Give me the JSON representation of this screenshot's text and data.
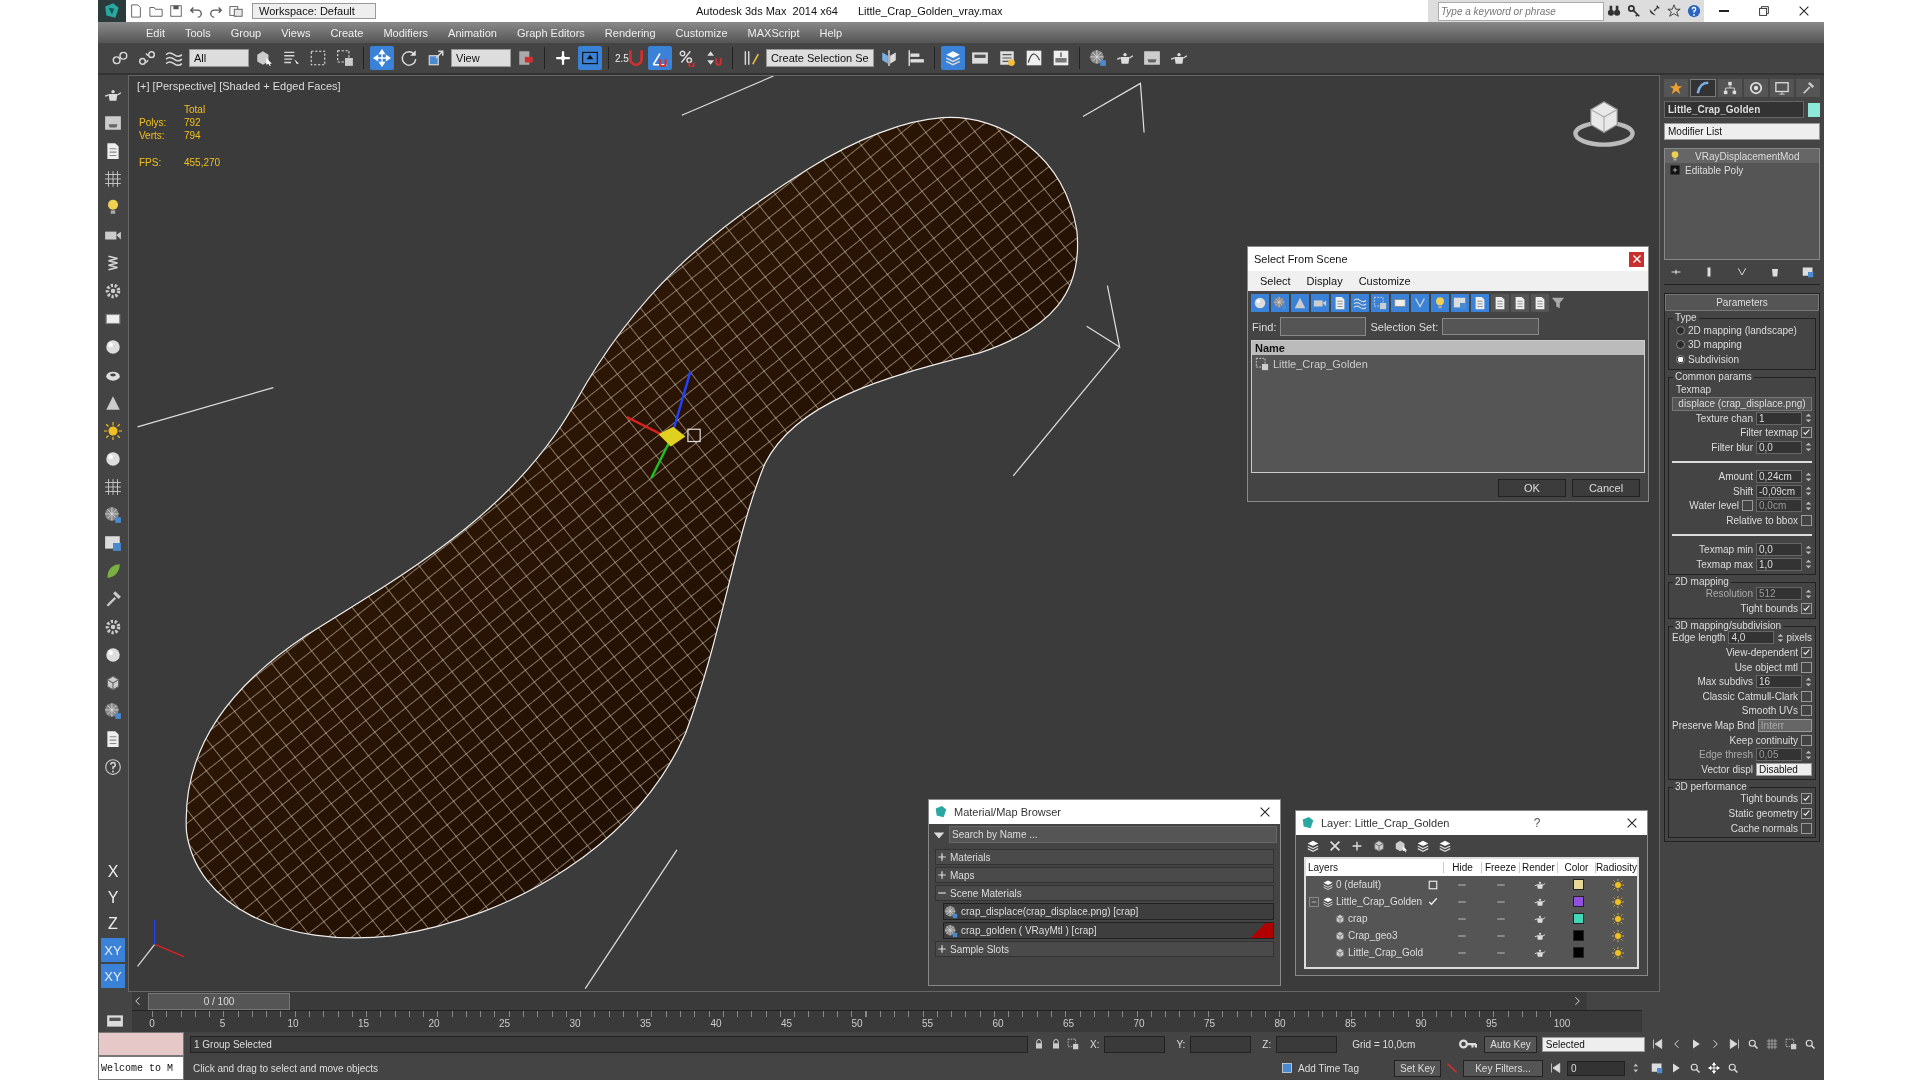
{
  "title_bar": {
    "workspace": "Workspace: Default",
    "app_title": "Autodesk 3ds Max  2014 x64",
    "file_name": "Little_Crap_Golden_vray.max",
    "search": {
      "placeholder": "Type a keyword or phrase"
    }
  },
  "menu": [
    "Edit",
    "Tools",
    "Group",
    "Views",
    "Create",
    "Modifiers",
    "Animation",
    "Graph Editors",
    "Rendering",
    "Customize",
    "MAXScript",
    "Help"
  ],
  "main_toolbar": {
    "dropdowns": [
      "All",
      "View",
      "Create Selection Se"
    ],
    "tools": [
      {
        "selected": false
      },
      {
        "selected": false
      },
      {
        "selected": false
      },
      {
        "selected": false
      },
      {
        "selected": false
      },
      {
        "selected": false
      },
      {
        "selected": false
      },
      {
        "selected": true
      },
      {
        "selected": false
      },
      {
        "selected": false
      },
      {
        "selected": false
      },
      {
        "selected": false
      },
      {
        "selected": true
      },
      {
        "selected": false,
        "label": "2.5"
      },
      {
        "selected": true
      },
      {
        "selected": false
      },
      {
        "selected": false
      },
      {
        "selected": false
      },
      {
        "selected": false
      },
      {
        "selected": false
      },
      {
        "selected": true
      },
      {
        "selected": false
      },
      {
        "selected": false
      },
      {
        "selected": false
      },
      {
        "selected": false
      },
      {
        "selected": false
      },
      {
        "selected": false
      },
      {
        "selected": false
      },
      {
        "selected": false
      }
    ]
  },
  "axis_buttons": [
    {
      "label": "X",
      "selected": false
    },
    {
      "label": "Y",
      "selected": false
    },
    {
      "label": "Z",
      "selected": false
    },
    {
      "label": "XY",
      "selected": true
    },
    {
      "label": "XY",
      "selected": true
    }
  ],
  "viewport": {
    "label": "[+] [Perspective] [Shaded + Edged Faces]",
    "stats_heading": "Total",
    "stats": [
      {
        "label": "Polys:",
        "value": "792"
      },
      {
        "label": "Verts:",
        "value": "794"
      }
    ],
    "fps": {
      "label": "FPS:",
      "value": "455,270"
    }
  },
  "select_from_scene": {
    "title": "Select From Scene",
    "menus": [
      "Select",
      "Display",
      "Customize"
    ],
    "filters": [
      {
        "selected": true
      },
      {
        "selected": true
      },
      {
        "selected": true
      },
      {
        "selected": true
      },
      {
        "selected": true
      },
      {
        "selected": true
      },
      {
        "selected": true
      },
      {
        "selected": true
      },
      {
        "selected": true
      },
      {
        "selected": true
      },
      {
        "selected": true
      },
      {
        "selected": true
      },
      {
        "selected": false
      },
      {
        "selected": false
      },
      {
        "selected": false
      }
    ],
    "find_label": "Find:",
    "selection_set_label": "Selection Set:",
    "column": "Name",
    "rows": [
      "Little_Crap_Golden"
    ],
    "buttons": [
      "OK",
      "Cancel"
    ]
  },
  "material_browser": {
    "title": "Material/Map Browser",
    "search": {
      "placeholder": "Search by Name ..."
    },
    "groups": [
      {
        "label": "Materials",
        "expanded": false
      },
      {
        "label": "Maps",
        "expanded": false
      },
      {
        "label": "Scene Materials",
        "expanded": true,
        "items": [
          {
            "label": "crap_displace(crap_displace.png) [crap]",
            "in_scene": false
          },
          {
            "label": "crap_golden  ( VRayMtl ) [crap]",
            "in_scene": true
          }
        ]
      },
      {
        "label": "Sample Slots",
        "expanded": false
      }
    ]
  },
  "layer_dialog": {
    "title": "Layer: Little_Crap_Golden",
    "help": "?",
    "columns": [
      "Layers",
      "Hide",
      "Freeze",
      "Render",
      "Color",
      "Radiosity"
    ],
    "rows": [
      {
        "name": "0 (default)",
        "kind": "layer",
        "current": false,
        "color": "#e8d898"
      },
      {
        "name": "Little_Crap_Golden",
        "kind": "layer",
        "current": true,
        "expanded": true,
        "color": "#9050e0",
        "children": [
          {
            "name": "crap",
            "kind": "object",
            "color": "#40d8b8"
          },
          {
            "name": "Crap_geo3",
            "kind": "object",
            "color": "#000000"
          },
          {
            "name": "Little_Crap_Gold",
            "kind": "object",
            "color": "#000000"
          }
        ]
      }
    ]
  },
  "command_panel": {
    "tabs": [
      {
        "selected": false
      },
      {
        "selected": true
      },
      {
        "selected": false
      },
      {
        "selected": false
      },
      {
        "selected": false
      },
      {
        "selected": false
      }
    ],
    "object_name": "Little_Crap_Golden",
    "modifier_list": "Modifier List",
    "stack": [
      {
        "label": "VRayDisplacementMod",
        "kind": "modifier",
        "selected": true
      },
      {
        "label": "Editable Poly",
        "kind": "base",
        "selected": false
      }
    ],
    "rollout_title": "Parameters",
    "groups": [
      {
        "title": "Type",
        "rows": [
          {
            "kind": "radio",
            "label": "2D mapping (landscape)",
            "selected": false
          },
          {
            "kind": "radio",
            "label": "3D mapping",
            "selected": false
          },
          {
            "kind": "radio",
            "label": "Subdivision",
            "selected": true
          }
        ]
      },
      {
        "title": "Common params",
        "rows": [
          {
            "kind": "label",
            "label": "Texmap"
          },
          {
            "kind": "button",
            "label": "displace (crap_displace.png)"
          },
          {
            "kind": "spinner",
            "label": "Texture chan",
            "value": "1",
            "disabled": false
          },
          {
            "kind": "checkbox",
            "label": "Filter texmap",
            "checked": true
          },
          {
            "kind": "spinner",
            "label": "Filter blur",
            "value": "0,0",
            "disabled": false
          },
          {
            "kind": "separator"
          },
          {
            "kind": "spinner",
            "label": "Amount",
            "value": "0,24cm",
            "disabled": false
          },
          {
            "kind": "spinner",
            "label": "Shift",
            "value": "-0,09cm",
            "disabled": false
          },
          {
            "kind": "checkspinner",
            "label": "Water level",
            "checked": false,
            "value": "0,0cm",
            "disabled": true
          },
          {
            "kind": "checkbox",
            "label": "Relative to bbox",
            "checked": false
          },
          {
            "kind": "separator"
          },
          {
            "kind": "spinner",
            "label": "Texmap min",
            "value": "0,0",
            "disabled": false
          },
          {
            "kind": "spinner",
            "label": "Texmap max",
            "value": "1,0",
            "disabled": false
          }
        ]
      },
      {
        "title": "2D mapping",
        "rows": [
          {
            "kind": "spinner",
            "label": "Resolution",
            "value": "512",
            "disabled": true
          },
          {
            "kind": "checkbox",
            "label": "Tight bounds",
            "checked": true
          }
        ]
      },
      {
        "title": "3D mapping/subdivision",
        "rows": [
          {
            "kind": "spinner",
            "label": "Edge length",
            "value": "4,0",
            "unit": "pixels",
            "disabled": false
          },
          {
            "kind": "checkbox",
            "label": "View-dependent",
            "checked": true
          },
          {
            "kind": "checkbox",
            "label": "Use object mtl",
            "checked": false
          },
          {
            "kind": "spinner",
            "label": "Max subdivs",
            "value": "16",
            "disabled": false
          },
          {
            "kind": "checkbox",
            "label": "Classic Catmull-Clark",
            "checked": false
          },
          {
            "kind": "checkbox",
            "label": "Smooth UVs",
            "checked": false
          },
          {
            "kind": "dropdown",
            "label": "Preserve Map Bnd",
            "value": "Interr",
            "disabled": true
          },
          {
            "kind": "checkbox",
            "label": "Keep continuity",
            "checked": false
          },
          {
            "kind": "spinner",
            "label": "Edge thresh",
            "value": "0,05",
            "disabled": true
          },
          {
            "kind": "dropdown",
            "label": "Vector displ",
            "value": "Disabled",
            "disabled": false
          }
        ]
      },
      {
        "title": "3D performance",
        "rows": [
          {
            "kind": "checkbox",
            "label": "Tight bounds",
            "checked": true
          },
          {
            "kind": "checkbox",
            "label": "Static geometry",
            "checked": true
          },
          {
            "kind": "checkbox",
            "label": "Cache normals",
            "checked": false
          }
        ]
      }
    ]
  },
  "time_slider": {
    "label": "0 / 100",
    "level": 0
  },
  "ruler": [
    "0",
    "5",
    "10",
    "15",
    "20",
    "25",
    "30",
    "35",
    "40",
    "45",
    "50",
    "55",
    "60",
    "65",
    "70",
    "75",
    "80",
    "85",
    "90",
    "95",
    "100"
  ],
  "status_bar": {
    "welcome": "Welcome to M",
    "selection": "1 Group Selected",
    "prompt": "Click and drag to select and move objects",
    "coords": [
      "X:",
      "Y:",
      "Z:"
    ],
    "grid": "Grid = 10,0cm",
    "add_time_tag": "Add Time Tag",
    "auto_key": "Auto Key",
    "key_mode": "Selected",
    "set_key": "Set Key",
    "key_filters": "Key Filters...",
    "frame": "0"
  }
}
